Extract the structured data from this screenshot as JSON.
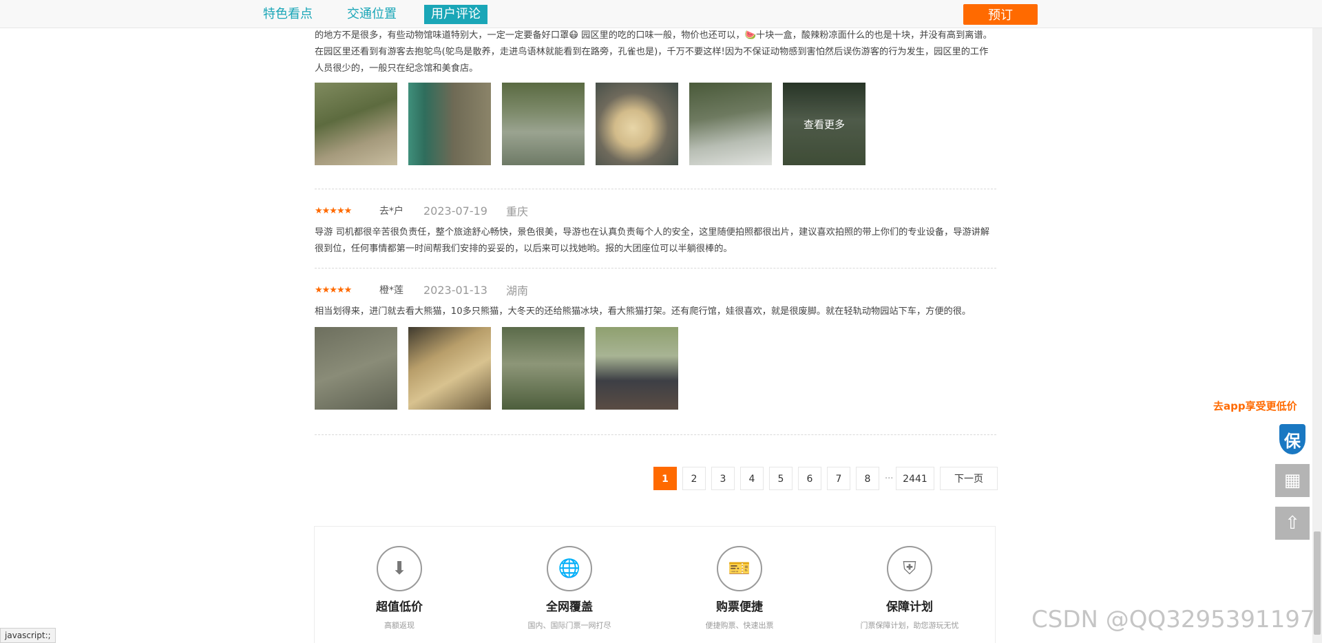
{
  "nav": {
    "tabs": [
      {
        "label": "特色看点",
        "active": false
      },
      {
        "label": "交通位置",
        "active": false
      },
      {
        "label": "用户评论",
        "active": true
      }
    ],
    "book_label": "预订"
  },
  "reviews": [
    {
      "text": "的地方不是很多，有些动物馆味道特别大，一定一定要备好口罩😷 园区里的吃的口味一般，物价也还可以，🍉十块一盒，酸辣粉凉面什么的也是十块，并没有高到离谱。 在园区里还看到有游客去抱鸵鸟(鸵鸟是散养，走进鸟语林就能看到在路旁，孔雀也是)，千万不要这样!因为不保证动物感到害怕然后误伤游客的行为发生，园区里的工作人员很少的，一般只在纪念馆和美食店。",
      "more_label": "查看更多"
    },
    {
      "stars": "★★★★★",
      "user": "去*户",
      "date": "2023-07-19",
      "city": "重庆",
      "text": "导游 司机都很辛苦很负责任，整个旅途舒心畅快，景色很美，导游也在认真负责每个人的安全，这里随便拍照都很出片，建议喜欢拍照的带上你们的专业设备，导游讲解很到位，任何事情都第一时间帮我们安排的妥妥的，以后来可以找她哟。报的大团座位可以半躺很棒的。"
    },
    {
      "stars": "★★★★★",
      "user": "橙*莲",
      "date": "2023-01-13",
      "city": "湖南",
      "text": "相当划得来，进门就去看大熊猫，10多只熊猫，大冬天的还给熊猫冰块，看大熊猫打架。还有爬行馆，娃很喜欢，就是很废脚。就在轻轨动物园站下车，方便的很。"
    }
  ],
  "pagination": {
    "pages": [
      "1",
      "2",
      "3",
      "4",
      "5",
      "6",
      "7",
      "8"
    ],
    "ellipsis": "···",
    "last": "2441",
    "next": "下一页",
    "current": "1"
  },
  "features": [
    {
      "title": "超值低价",
      "sub": "高额返现",
      "icon": "down-arrow-icon"
    },
    {
      "title": "全网覆盖",
      "sub": "国内、国际门票一网打尽",
      "icon": "globe-icon"
    },
    {
      "title": "购票便捷",
      "sub": "便捷购票、快速出票",
      "icon": "ticket-icon"
    },
    {
      "title": "保障计划",
      "sub": "门票保障计划，助您游玩无忧",
      "icon": "shield-icon"
    }
  ],
  "side": {
    "promo": "去app享受更低价",
    "shield_label": "保"
  },
  "status_text": "javascript:;",
  "watermark": "CSDN @QQ3295391197",
  "colors": {
    "accent": "#1aa6b7",
    "orange": "#ff6a00"
  }
}
